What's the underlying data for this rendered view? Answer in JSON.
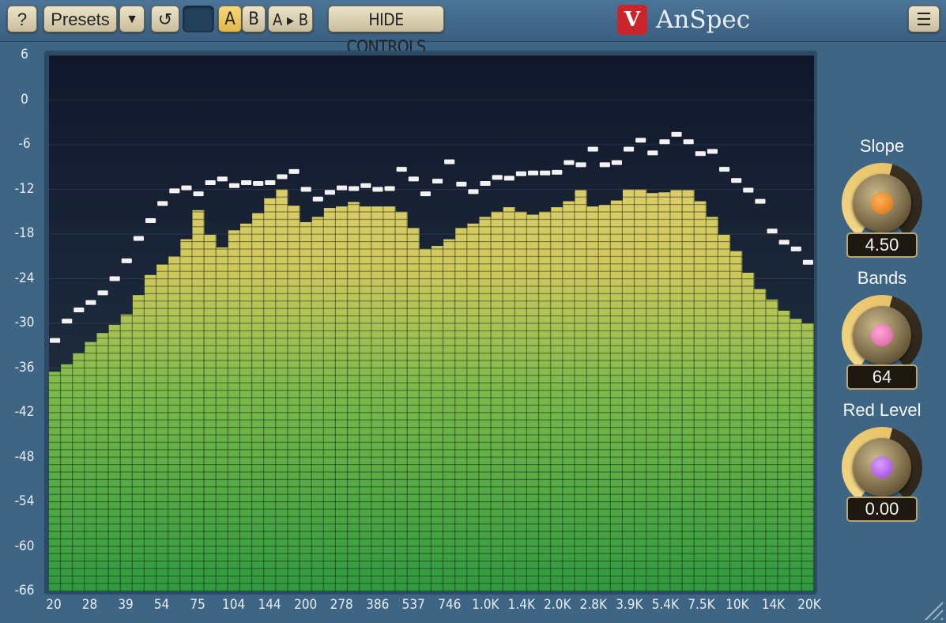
{
  "app": {
    "title": "AnSpec",
    "logo_text": "V",
    "accent": "#c9252b"
  },
  "toolbar": {
    "help_label": "?",
    "presets_label": "Presets",
    "presets_dropdown_label": "▼",
    "undo_label": "↺",
    "redo_label": "",
    "a_label": "A",
    "b_label": "B",
    "ab_label": "A ▸ B",
    "hide_controls_label": "HIDE CONTROLS",
    "menu_label": "☰"
  },
  "controls": [
    {
      "label": "Slope",
      "value": "4.50",
      "cap_color": "#f08a1e"
    },
    {
      "label": "Bands",
      "value": "64",
      "cap_color": "#e56fae"
    },
    {
      "label": "Red Level",
      "value": "0.00",
      "cap_color": "#b35ae6"
    }
  ],
  "chart_data": {
    "type": "bar",
    "y_tick_labels": [
      "6",
      "0",
      "-6",
      "-12",
      "-18",
      "-24",
      "-30",
      "-36",
      "-42",
      "-48",
      "-54",
      "-60",
      "-66"
    ],
    "x_tick_labels": [
      "20",
      "28",
      "39",
      "54",
      "75",
      "104",
      "144",
      "200",
      "278",
      "386",
      "537",
      "746",
      "1.0K",
      "1.4K",
      "2.0K",
      "2.8K",
      "3.9K",
      "5.4K",
      "7.5K",
      "10K",
      "14K",
      "20K"
    ],
    "ylim": [
      -66,
      6
    ],
    "bands": 64,
    "levels": [
      -36.5,
      -35.5,
      -34,
      -32.5,
      -31.3,
      -30.2,
      -28.8,
      -26.2,
      -23.5,
      -22.1,
      -21,
      -18.7,
      -14.8,
      -18.1,
      -19.8,
      -17.5,
      -16.6,
      -15.2,
      -13.2,
      -12,
      -14.2,
      -16.4,
      -15.7,
      -14.5,
      -14.3,
      -13.7,
      -14.3,
      -14.3,
      -14.3,
      -15,
      -17.2,
      -20,
      -19.6,
      -18.7,
      -17.2,
      -16.6,
      -15.7,
      -15,
      -14.4,
      -15,
      -15.4,
      -15,
      -14.4,
      -13.6,
      -12.1,
      -14.3,
      -14.1,
      -13.5,
      -12,
      -12,
      -12.5,
      -12.4,
      -12.1,
      -12.1,
      -13.6,
      -15.7,
      -18.1,
      -20.3,
      -23.2,
      -25.4,
      -26.8,
      -28.3,
      -29.4,
      -30
    ],
    "peaks": [
      -32.3,
      -29.7,
      -28.2,
      -27.2,
      -25.9,
      -24,
      -21.6,
      -18.6,
      -16.2,
      -13.9,
      -12.2,
      -11.8,
      -12.6,
      -11.1,
      -10.6,
      -11.5,
      -11.1,
      -11.2,
      -11.1,
      -10.3,
      -9.6,
      -12,
      -13.3,
      -12.4,
      -11.8,
      -11.9,
      -11.5,
      -12,
      -11.9,
      -9.3,
      -10.6,
      -12.6,
      -10.9,
      -8.3,
      -11.3,
      -12.3,
      -11.2,
      -10.4,
      -10.5,
      -9.9,
      -9.8,
      -9.8,
      -9.7,
      -8.4,
      -8.7,
      -6.6,
      -8.7,
      -8.4,
      -6.6,
      -5.4,
      -7.1,
      -5.6,
      -4.6,
      -5.6,
      -7.2,
      -6.9,
      -9.3,
      -10.8,
      -12.1,
      -13.6,
      -17.6,
      -19.1,
      -20,
      -21.8
    ]
  }
}
